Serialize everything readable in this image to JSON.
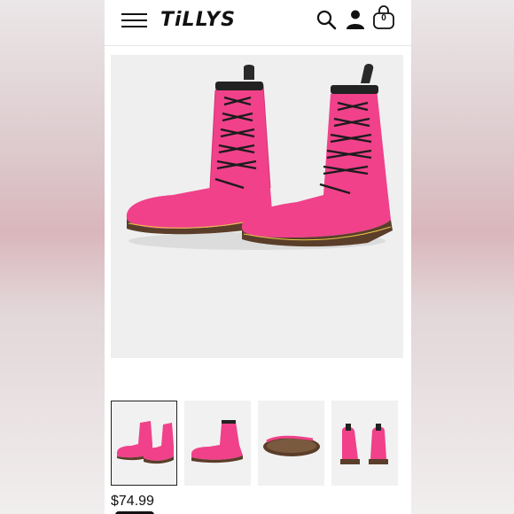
{
  "brand": {
    "logo_text": "TiLLYS"
  },
  "header": {
    "menu_icon": "hamburger-icon",
    "search_icon": "search-icon",
    "account_icon": "user-icon",
    "bag_icon": "shopping-bag-icon",
    "bag_count": "0"
  },
  "product": {
    "image_icon": "pink-combat-boots-photo",
    "price": "$74.99",
    "accent_color": "#f0418a"
  },
  "thumbnails": [
    {
      "view": "pair-front",
      "selected": true
    },
    {
      "view": "side"
    },
    {
      "view": "sole"
    },
    {
      "view": "back"
    }
  ]
}
